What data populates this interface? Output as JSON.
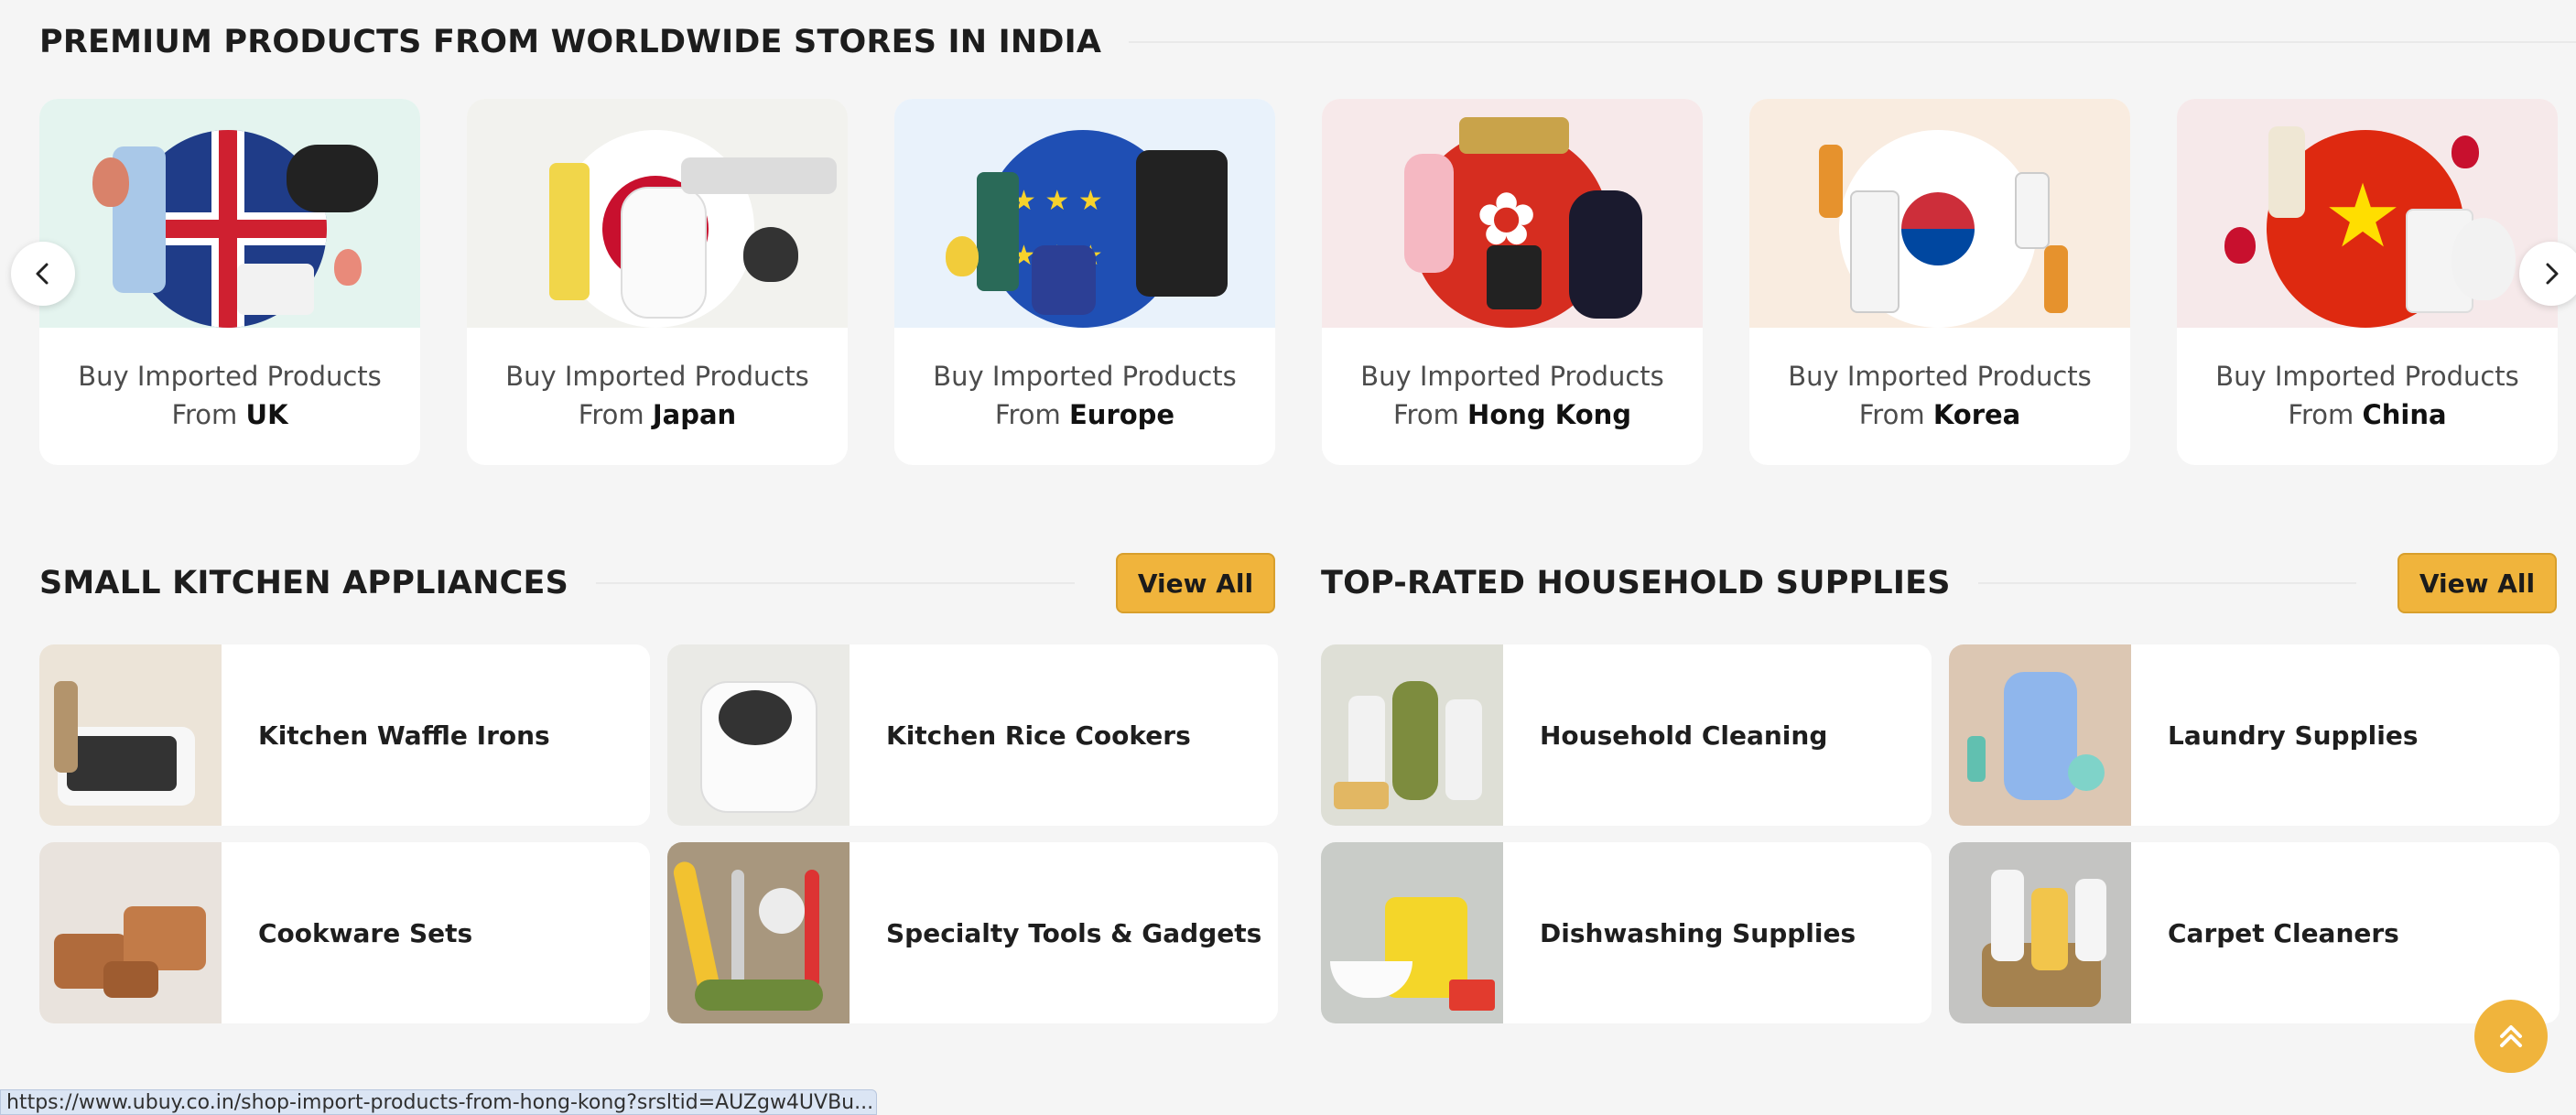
{
  "premium": {
    "title": "PREMIUM PRODUCTS FROM WORLDWIDE STORES IN INDIA",
    "cards": [
      {
        "line1": "Buy Imported Products",
        "prefix": "From",
        "country": "UK"
      },
      {
        "line1": "Buy Imported Products",
        "prefix": "From",
        "country": "Japan"
      },
      {
        "line1": "Buy Imported Products",
        "prefix": "From",
        "country": "Europe"
      },
      {
        "line1": "Buy Imported Products",
        "prefix": "From",
        "country": "Hong Kong"
      },
      {
        "line1": "Buy Imported Products",
        "prefix": "From",
        "country": "Korea"
      },
      {
        "line1": "Buy Imported Products",
        "prefix": "From",
        "country": "China"
      }
    ]
  },
  "kitchen": {
    "title": "SMALL KITCHEN APPLIANCES",
    "view_all": "View All",
    "items": [
      {
        "label": "Kitchen Waffle Irons"
      },
      {
        "label": "Kitchen Rice Cookers"
      },
      {
        "label": "Cookware Sets"
      },
      {
        "label": "Specialty Tools & Gadgets"
      }
    ]
  },
  "household": {
    "title": "TOP-RATED HOUSEHOLD SUPPLIES",
    "view_all": "View All",
    "items": [
      {
        "label": "Household Cleaning"
      },
      {
        "label": "Laundry Supplies"
      },
      {
        "label": "Dishwashing Supplies"
      },
      {
        "label": "Carpet Cleaners"
      }
    ]
  },
  "status_bar": {
    "url": "https://www.ubuy.co.in/shop-import-products-from-hong-kong?srsltid=AUZgw4UVBu..."
  },
  "colors": {
    "accent": "#f0b43c",
    "page_bg": "#f5f5f5",
    "card_bg": "#ffffff"
  },
  "icons": {
    "prev": "chevron-left-icon",
    "next": "chevron-right-icon",
    "scroll_top": "double-chevron-up-icon"
  }
}
